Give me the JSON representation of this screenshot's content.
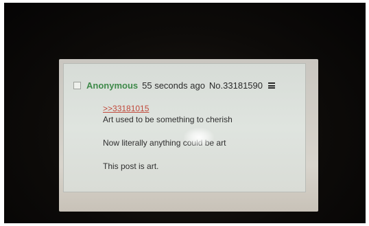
{
  "post": {
    "author": "Anonymous",
    "timestamp": "55 seconds ago",
    "post_number": "No.33181590",
    "menu_icon": "hamburger-menu-icon",
    "quote_link": ">>33181015",
    "lines": [
      "Art used to be something to cherish",
      "Now literally anything could be art",
      "This post is art."
    ]
  },
  "colors": {
    "name_green": "#3f8a4a",
    "quote_red": "#c0483a",
    "post_bg": "#dfe4df"
  }
}
